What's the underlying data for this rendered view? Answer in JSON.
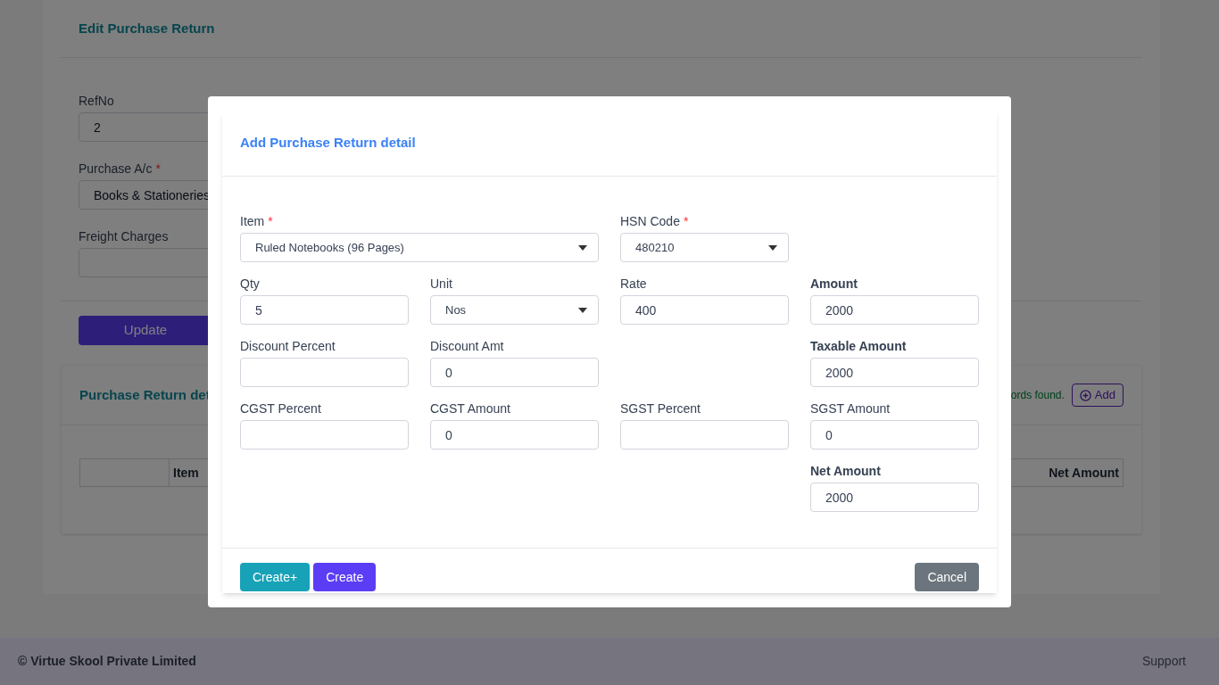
{
  "page": {
    "title": "Edit Purchase Return",
    "fields": [
      {
        "label": "RefNo",
        "value": "2"
      },
      {
        "label": "Purchase A/c",
        "required_mark": "*",
        "value": "Books & Stationeries"
      },
      {
        "label": "Freight Charges"
      }
    ],
    "update_button": "Update",
    "details": {
      "title": "Purchase Return det",
      "records_text": "ords found.",
      "add_button": "Add",
      "columns": [
        "",
        "Item",
        "Net Amount"
      ]
    }
  },
  "modal": {
    "title": "Add Purchase Return detail",
    "rows": [
      [
        {
          "kind": "wide-select",
          "label": "Item",
          "required_mark": "*",
          "bold": false,
          "value": "Ruled Notebooks (96 Pages)"
        },
        {
          "kind": "empty"
        },
        {
          "kind": "select",
          "label": "HSN Code",
          "required_mark": "*",
          "bold": false,
          "value": "480210"
        },
        {
          "kind": "empty"
        }
      ],
      [
        {
          "kind": "input",
          "label": "Qty",
          "bold": false,
          "value": "5"
        },
        {
          "kind": "select",
          "label": "Unit",
          "bold": false,
          "value": "Nos"
        },
        {
          "kind": "input",
          "label": "Rate",
          "bold": false,
          "value": "400"
        },
        {
          "kind": "input",
          "label": "Amount",
          "bold": true,
          "value": "2000"
        }
      ],
      [
        {
          "kind": "input",
          "label": "Discount Percent",
          "bold": false
        },
        {
          "kind": "input",
          "label": "Discount Amt",
          "bold": false,
          "value": "0"
        },
        {
          "kind": "empty"
        },
        {
          "kind": "input",
          "label": "Taxable Amount",
          "bold": true,
          "value": "2000"
        }
      ],
      [
        {
          "kind": "input",
          "label": "CGST Percent",
          "bold": false
        },
        {
          "kind": "input",
          "label": "CGST Amount",
          "bold": false,
          "value": "0"
        },
        {
          "kind": "input",
          "label": "SGST Percent",
          "bold": false
        },
        {
          "kind": "input",
          "label": "SGST Amount",
          "bold": false,
          "value": "0"
        }
      ],
      [
        {
          "kind": "empty"
        },
        {
          "kind": "empty"
        },
        {
          "kind": "empty"
        },
        {
          "kind": "input",
          "label": "Net Amount",
          "bold": true,
          "value": "2000"
        }
      ]
    ],
    "buttons": [
      {
        "kind": "create-plus",
        "label": "Create+"
      },
      {
        "kind": "create",
        "label": "Create"
      },
      {
        "kind": "cancel",
        "label": "Cancel"
      }
    ]
  },
  "footer": {
    "copyright": "© Virtue Skool Private Limited",
    "link": "Support"
  }
}
